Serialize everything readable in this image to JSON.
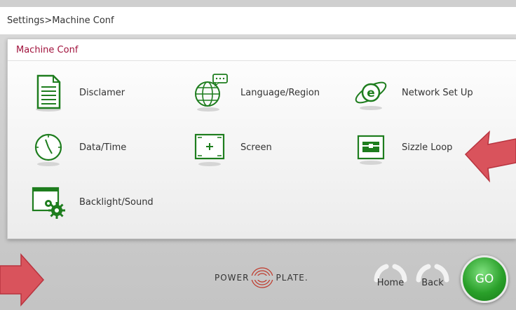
{
  "breadcrumb": {
    "text": "Settings>Machine Conf"
  },
  "panel": {
    "title": "Machine Conf"
  },
  "menu": {
    "items": [
      {
        "label": "Disclamer",
        "icon": "document-icon"
      },
      {
        "label": "Language/Region",
        "icon": "globe-icon"
      },
      {
        "label": "Network Set Up",
        "icon": "network-icon"
      },
      {
        "label": "Data/Time",
        "icon": "clock-icon"
      },
      {
        "label": "Screen",
        "icon": "screen-icon"
      },
      {
        "label": "Sizzle Loop",
        "icon": "sizzle-loop-icon"
      },
      {
        "label": "Backlight/Sound",
        "icon": "backlight-sound-icon"
      }
    ]
  },
  "footer": {
    "logo_left": "POWER",
    "logo_right": "PLATE.",
    "home_label": "Home",
    "back_label": "Back",
    "go_label": "GO"
  },
  "colors": {
    "accent_green": "#2a8a2a",
    "header_text": "#a1123c",
    "arrow_red": "#d9535c"
  }
}
